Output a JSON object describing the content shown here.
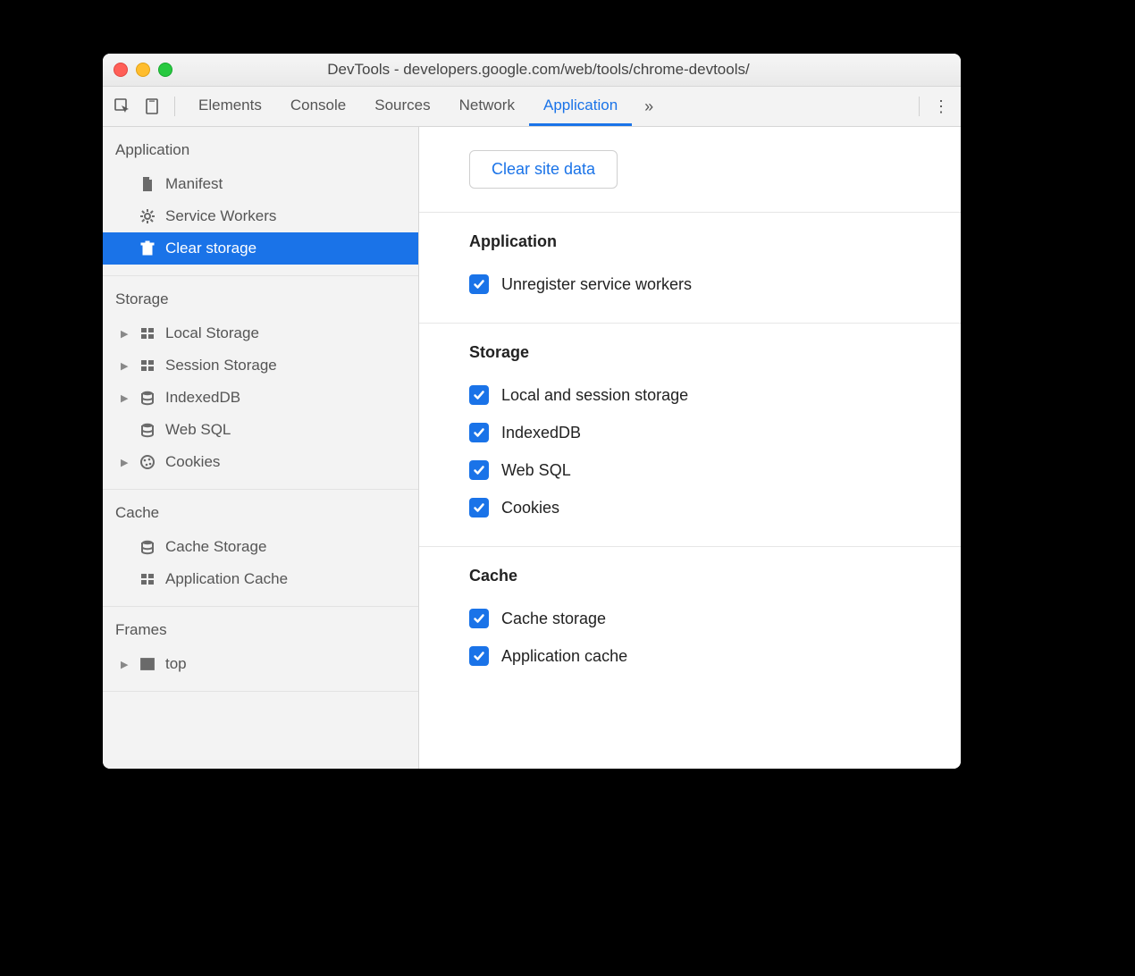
{
  "window": {
    "title": "DevTools - developers.google.com/web/tools/chrome-devtools/"
  },
  "toolbar": {
    "tabs": [
      "Elements",
      "Console",
      "Sources",
      "Network",
      "Application"
    ],
    "active_tab": "Application"
  },
  "sidebar": {
    "groups": [
      {
        "title": "Application",
        "items": [
          {
            "label": "Manifest",
            "icon": "file",
            "expandable": false,
            "selected": false
          },
          {
            "label": "Service Workers",
            "icon": "gear",
            "expandable": false,
            "selected": false
          },
          {
            "label": "Clear storage",
            "icon": "trash",
            "expandable": false,
            "selected": true
          }
        ]
      },
      {
        "title": "Storage",
        "items": [
          {
            "label": "Local Storage",
            "icon": "grid",
            "expandable": true,
            "selected": false
          },
          {
            "label": "Session Storage",
            "icon": "grid",
            "expandable": true,
            "selected": false
          },
          {
            "label": "IndexedDB",
            "icon": "db",
            "expandable": true,
            "selected": false
          },
          {
            "label": "Web SQL",
            "icon": "db",
            "expandable": false,
            "selected": false
          },
          {
            "label": "Cookies",
            "icon": "cookie",
            "expandable": true,
            "selected": false
          }
        ]
      },
      {
        "title": "Cache",
        "items": [
          {
            "label": "Cache Storage",
            "icon": "db",
            "expandable": false,
            "selected": false
          },
          {
            "label": "Application Cache",
            "icon": "grid",
            "expandable": false,
            "selected": false
          }
        ]
      },
      {
        "title": "Frames",
        "items": [
          {
            "label": "top",
            "icon": "frame",
            "expandable": true,
            "selected": false
          }
        ]
      }
    ]
  },
  "main": {
    "clear_button": "Clear site data",
    "sections": [
      {
        "title": "Application",
        "checks": [
          {
            "label": "Unregister service workers",
            "checked": true
          }
        ]
      },
      {
        "title": "Storage",
        "checks": [
          {
            "label": "Local and session storage",
            "checked": true
          },
          {
            "label": "IndexedDB",
            "checked": true
          },
          {
            "label": "Web SQL",
            "checked": true
          },
          {
            "label": "Cookies",
            "checked": true
          }
        ]
      },
      {
        "title": "Cache",
        "checks": [
          {
            "label": "Cache storage",
            "checked": true
          },
          {
            "label": "Application cache",
            "checked": true
          }
        ]
      }
    ]
  }
}
